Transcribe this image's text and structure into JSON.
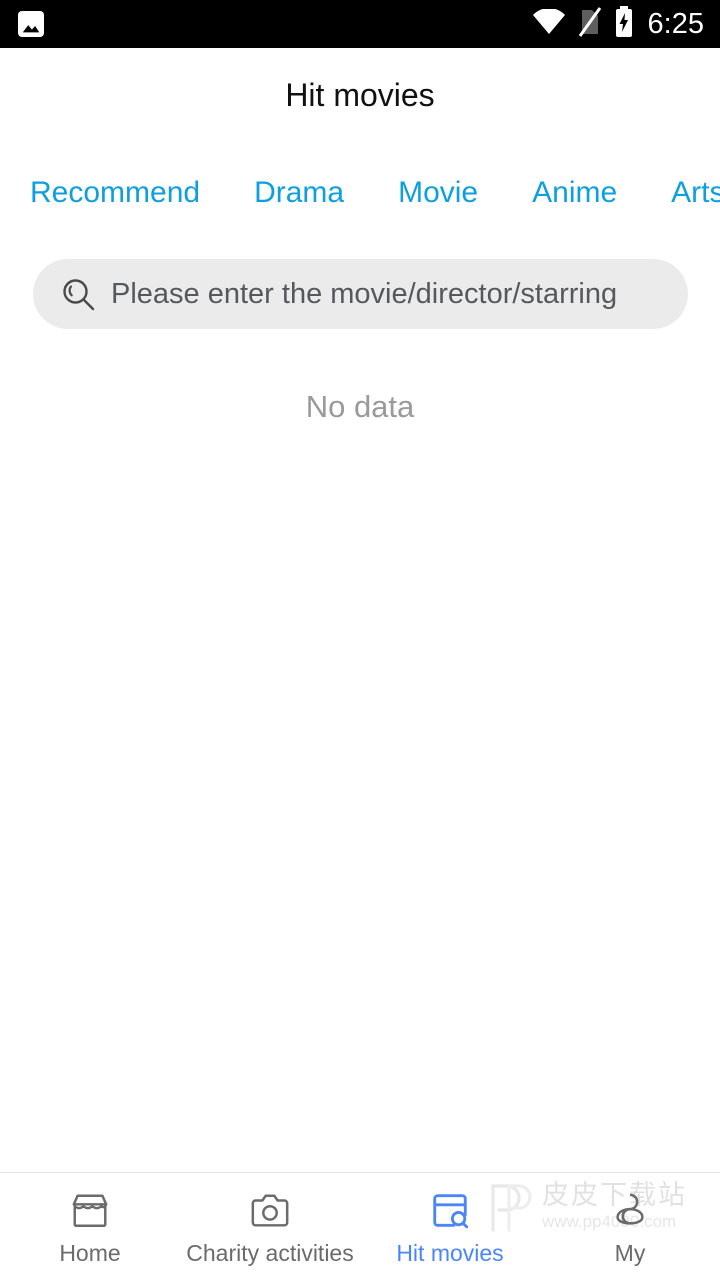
{
  "status_bar": {
    "left_icons": [
      {
        "name": "photo-icon",
        "label": "image"
      }
    ],
    "right_icons": [
      {
        "name": "wifi-icon",
        "label": "wifi"
      },
      {
        "name": "no-sim-icon",
        "label": "no-sim"
      },
      {
        "name": "battery-charging-icon",
        "label": "battery-charging"
      }
    ],
    "time": "6:25",
    "background": "#000000",
    "foreground": "#ffffff"
  },
  "header": {
    "title": "Hit movies"
  },
  "tabs": {
    "active_index": 0,
    "color": "#0d9fe0",
    "items": [
      {
        "label": "Recommend"
      },
      {
        "label": "Drama"
      },
      {
        "label": "Movie"
      },
      {
        "label": "Anime"
      },
      {
        "label": "Arts"
      }
    ]
  },
  "search": {
    "icon": "search-history-icon",
    "placeholder": "Please enter the movie/director/starring",
    "value": "",
    "background": "#ebebeb"
  },
  "content": {
    "empty_text": "No data",
    "empty_text_color": "#9a9a9a"
  },
  "bottom_nav": {
    "active_index": 2,
    "active_color": "#4a86f7",
    "inactive_color": "#6b6b6b",
    "items": [
      {
        "label": "Home",
        "icon": "storefront-icon"
      },
      {
        "label": "Charity activities",
        "icon": "camera-icon"
      },
      {
        "label": "Hit movies",
        "icon": "window-search-icon"
      },
      {
        "label": "My",
        "icon": "person-icon"
      }
    ]
  },
  "watermark": {
    "text_cn": "皮皮下载站",
    "url": "www.pp4000.com",
    "logo": "pp-logo-icon"
  }
}
